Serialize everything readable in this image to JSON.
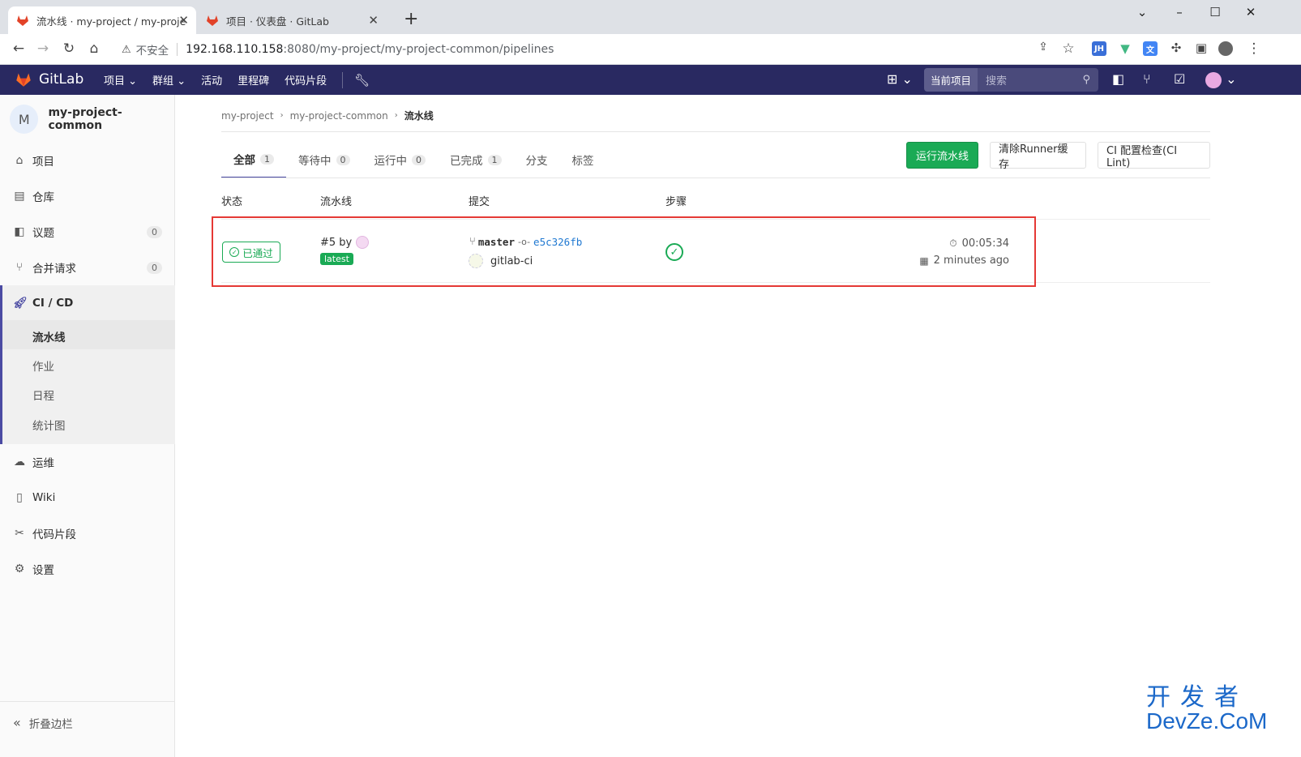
{
  "browser": {
    "tabs": [
      {
        "title": "流水线 · my-project / my-proje",
        "active": true
      },
      {
        "title": "项目 · 仪表盘 · GitLab",
        "active": false
      }
    ],
    "new_tab": "+",
    "address": {
      "warning": "不安全",
      "host": "192.168.110.158",
      "path": ":8080/my-project/my-project-common/pipelines"
    },
    "extensions": [
      {
        "name": "JH",
        "color": "#3a6fd8"
      },
      {
        "name": "V",
        "color": "#42b883"
      },
      {
        "name": "translate",
        "color": "#4285f4"
      }
    ]
  },
  "header": {
    "brand": "GitLab",
    "nav": [
      "项目",
      "群组",
      "活动",
      "里程碑",
      "代码片段"
    ],
    "search_scope": "当前项目",
    "search_placeholder": "搜索"
  },
  "sidebar": {
    "project_initial": "M",
    "project_name": "my-project-common",
    "items": [
      {
        "label": "项目",
        "icon": "home-icon"
      },
      {
        "label": "仓库",
        "icon": "book-icon"
      },
      {
        "label": "议题",
        "icon": "issues-icon",
        "count": "0"
      },
      {
        "label": "合并请求",
        "icon": "merge-request-icon",
        "count": "0"
      },
      {
        "label": "CI / CD",
        "icon": "rocket-icon"
      },
      {
        "label": "运维",
        "icon": "cloud-gear-icon"
      },
      {
        "label": "Wiki",
        "icon": "wiki-icon"
      },
      {
        "label": "代码片段",
        "icon": "scissors-icon"
      },
      {
        "label": "设置",
        "icon": "gear-icon"
      }
    ],
    "cicd_sub": [
      "流水线",
      "作业",
      "日程",
      "统计图"
    ],
    "collapse": "折叠边栏"
  },
  "breadcrumb": [
    "my-project",
    "my-project-common",
    "流水线"
  ],
  "pipeline_tabs": [
    {
      "label": "全部",
      "count": "1"
    },
    {
      "label": "等待中",
      "count": "0"
    },
    {
      "label": "运行中",
      "count": "0"
    },
    {
      "label": "已完成",
      "count": "1"
    },
    {
      "label": "分支"
    },
    {
      "label": "标签"
    }
  ],
  "buttons": {
    "run": "运行流水线",
    "clear_cache": "清除Runner缓存",
    "lint": "CI 配置检查(CI Lint)"
  },
  "table": {
    "headers": [
      "状态",
      "流水线",
      "提交",
      "步骤"
    ],
    "row": {
      "status": "已通过",
      "pipeline_id": "#5 by",
      "tag": "latest",
      "branch": "master",
      "sha": "e5c326fb",
      "commit_message": "gitlab-ci",
      "duration": "00:05:34",
      "finished": "2 minutes ago"
    }
  },
  "colors": {
    "header_bg": "#292961",
    "success": "#1aaa55",
    "highlight": "#e53935"
  },
  "watermark": {
    "top": "开发者",
    "bottom": "DevZe.CoM"
  }
}
